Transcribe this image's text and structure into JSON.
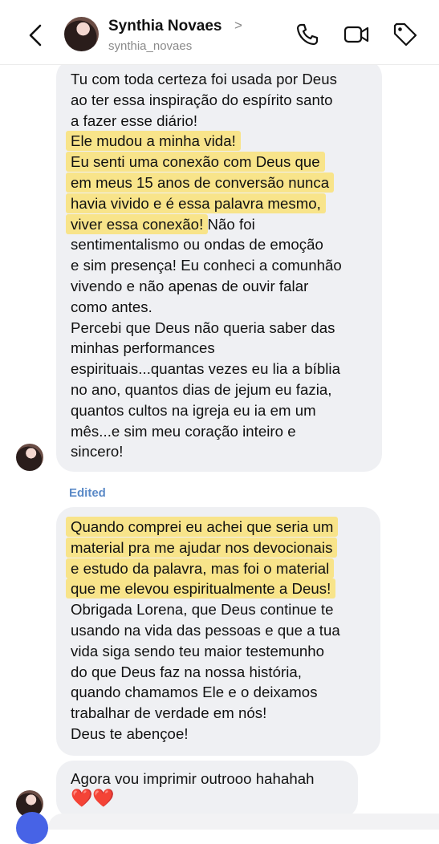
{
  "header": {
    "name": "Synthia Novaes",
    "chevron": ">",
    "handle": "synthia_novaes",
    "icons": [
      "back-icon",
      "phone-icon",
      "video-icon",
      "tag-icon"
    ]
  },
  "messages": [
    {
      "segments": [
        {
          "text": "Tu com toda certeza foi usada por Deus\nao ter essa inspiração do espírito santo\na fazer esse diário!\n",
          "hl": false
        },
        {
          "text": "Ele mudou a minha vida!",
          "hl": true
        },
        {
          "text": "\n",
          "hl": false
        },
        {
          "text": "Eu senti uma conexão com Deus que\nem meus 15 anos de conversão nunca\nhavia vivido e é essa palavra mesmo,\nviver essa conexão!",
          "hl": true
        },
        {
          "text": " Não foi\nsentimentalismo ou ondas de emoção\ne sim presença! Eu conheci a comunhão\nvivendo e não apenas de ouvir falar\ncomo antes.\nPercebi que Deus não queria saber das\nminhas performances\nespirituais...quantas vezes eu lia a bíblia\nno ano, quantos dias de jejum eu fazia,\nquantos cultos na igreja eu ia em um\nmês...e sim meu coração  inteiro e\nsincero!",
          "hl": false
        }
      ]
    },
    {
      "edited_label": "Edited",
      "segments": [
        {
          "text": "Quando comprei eu achei que seria um\nmaterial pra me ajudar nos devocionais\ne estudo da palavra, mas foi o material\nque me elevou espiritualmente a Deus!",
          "hl": true
        },
        {
          "text": "\nObrigada Lorena, que Deus continue te\nusando na vida das pessoas e que a tua\nvida siga sendo teu maior testemunho\ndo que Deus faz na nossa história,\nquando chamamos Ele e  o deixamos\ntrabalhar de verdade em nós!\nDeus te abençoe!",
          "hl": false
        }
      ]
    },
    {
      "segments": [
        {
          "text": "Agora vou imprimir outrooo  hahahah",
          "hl": false
        }
      ],
      "hearts": "❤️❤️"
    }
  ]
}
